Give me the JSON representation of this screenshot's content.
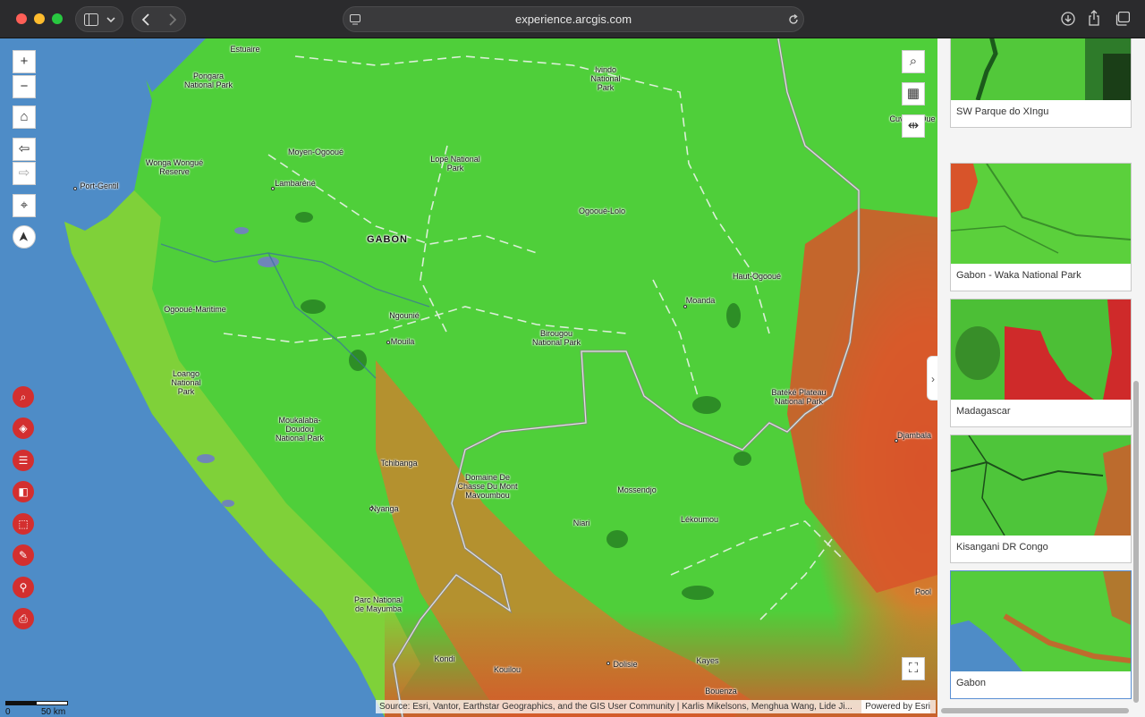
{
  "browser": {
    "url": "experience.arcgis.com",
    "icons": [
      "sidebar-icon",
      "chevron-down-icon",
      "back-icon",
      "forward-icon",
      "site-icon",
      "reload-icon",
      "download-icon",
      "share-icon",
      "tabs-icon"
    ]
  },
  "map": {
    "country_label": "GABON",
    "places": {
      "estuaire": "Estuaire",
      "pongara": "Pongara\nNational Park",
      "ivindo": "Ivindo\nNational\nPark",
      "cuvette": "Cuvette-Oue",
      "moyen_ogooue": "Moyen-Ogooué",
      "wonga": "Wonga Wongué\nReserve",
      "port_gentil": "Port-Gentil",
      "lambarene": "Lambaréné",
      "lope": "Lopé National\nPark",
      "ogooue_lolo": "Ogooué-Lolo",
      "haut_ogooue": "Haut-Ogooué",
      "moanda": "Moanda",
      "ogooue_maritime": "Ogooué-Maritime",
      "ngounie": "Ngounié",
      "mouila": "Mouila",
      "birougou": "Birougou\nNational Park",
      "loango": "Loango\nNational\nPark",
      "bateke": "Batéké Plateau\nNational Park",
      "moukalaba": "Moukalaba-\nDoudou\nNational Park",
      "djambala": "Djambala",
      "domaine": "Domaine De\nChasse Du Mont\nMavoumbou",
      "tchibanga": "Tchibanga",
      "nyanga": "Nyanga",
      "mossendjo": "Mossendjo",
      "niari": "Niari",
      "lekoumou": "Lékoumou",
      "pool": "Pool",
      "mayumba": "Parc National\nde Mayumba",
      "kondi": "Kondi",
      "kouilou": "Kouilou",
      "dolisie": "Dolisie",
      "kayes": "Kayes",
      "bouenza": "Bouenza"
    },
    "attribution": "Source: Esri, Vantor, Earthstar Geographics, and the GIS User Community | Karlis Mikelsons, Menghua Wang, Lide Ji...",
    "powered_by": "Powered by Esri",
    "scale": {
      "start": "0",
      "end": "50 km"
    },
    "tools": {
      "zoom_in": "+",
      "zoom_out": "−",
      "home": "⌂",
      "previous": "⇦",
      "next": "⇨",
      "locate": "⌖",
      "compass": "➤",
      "search": "⌕",
      "qr": "▦",
      "measure": "⇹",
      "fullscreen": "⛶"
    },
    "widgets": [
      "search-widget-icon",
      "layers-icon",
      "legend-icon",
      "swipe-icon",
      "select-icon",
      "basemap-icon",
      "share-network-icon",
      "print-icon"
    ],
    "colors": {
      "water": "#4e8cc7",
      "forest": "#4fcf3a",
      "degraded": "#d8542a",
      "dense": "#1c6b1c"
    }
  },
  "gallery": {
    "items": [
      {
        "label": "SW Parque do XIngu"
      },
      {
        "label": "Gabon - Waka National Park"
      },
      {
        "label": "Madagascar"
      },
      {
        "label": "Kisangani DR Congo"
      },
      {
        "label": "Gabon"
      }
    ],
    "selected": "Gabon"
  }
}
